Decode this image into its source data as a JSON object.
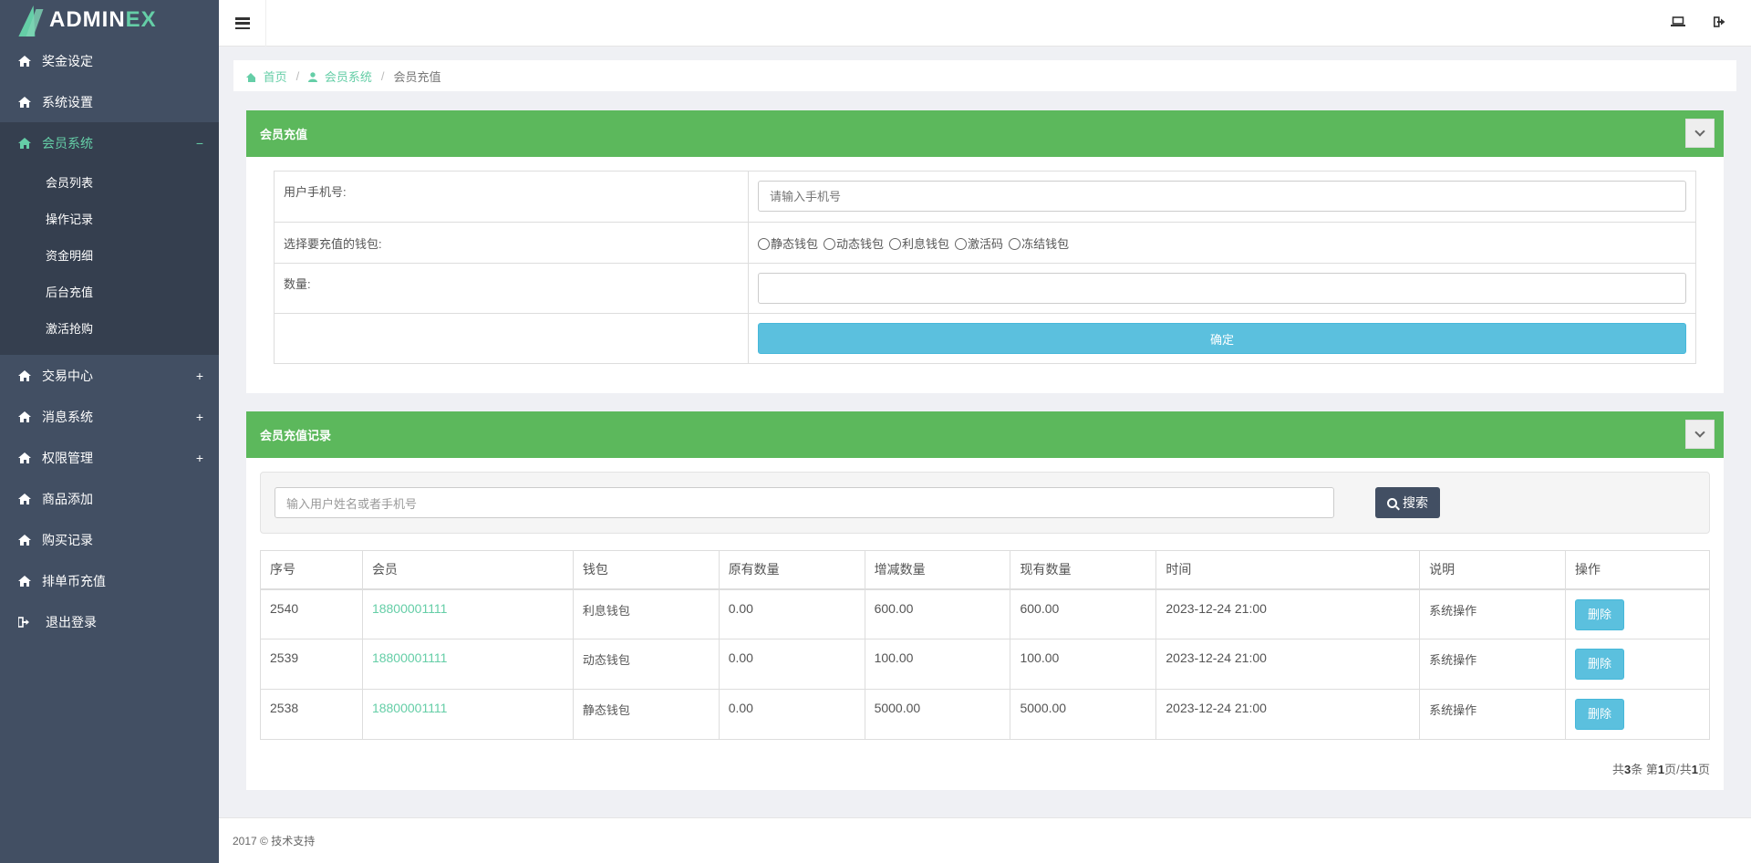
{
  "brand": {
    "part1": "ADMIN",
    "part2": "EX"
  },
  "sidebar": {
    "items": [
      {
        "label": "奖金设定",
        "toggle": ""
      },
      {
        "label": "系统设置",
        "toggle": ""
      },
      {
        "label": "会员系统",
        "toggle": "−"
      },
      {
        "label": "交易中心",
        "toggle": "+"
      },
      {
        "label": "消息系统",
        "toggle": "+"
      },
      {
        "label": "权限管理",
        "toggle": "+"
      },
      {
        "label": "商品添加",
        "toggle": ""
      },
      {
        "label": "购买记录",
        "toggle": ""
      },
      {
        "label": "排单币充值",
        "toggle": ""
      },
      {
        "label": "退出登录",
        "toggle": ""
      }
    ],
    "submenu": [
      "会员列表",
      "操作记录",
      "资金明细",
      "后台充值",
      "激活抢购"
    ]
  },
  "breadcrumb": {
    "home": "首页",
    "section": "会员系统",
    "current": "会员充值",
    "separator": "/"
  },
  "recharge_panel": {
    "title": "会员充值",
    "phone_label": "用户手机号:",
    "phone_placeholder": "请输入手机号",
    "wallet_label": "选择要充值的钱包:",
    "wallet_options": [
      "静态钱包",
      "动态钱包",
      "利息钱包",
      "激活码",
      "冻结钱包"
    ],
    "amount_label": "数量:",
    "amount_value": "",
    "confirm_label": "确定"
  },
  "records_panel": {
    "title": "会员充值记录",
    "search_placeholder": "输入用户姓名或者手机号",
    "search_label": "搜索",
    "columns": [
      "序号",
      "会员",
      "钱包",
      "原有数量",
      "增减数量",
      "现有数量",
      "时间",
      "说明",
      "操作"
    ],
    "rows": [
      {
        "id": "2540",
        "member": "18800001111",
        "wallet": "利息钱包",
        "original": "0.00",
        "change": "600.00",
        "current": "600.00",
        "time": "2023-12-24 21:00",
        "note": "系统操作",
        "action": "删除"
      },
      {
        "id": "2539",
        "member": "18800001111",
        "wallet": "动态钱包",
        "original": "0.00",
        "change": "100.00",
        "current": "100.00",
        "time": "2023-12-24 21:00",
        "note": "系统操作",
        "action": "删除"
      },
      {
        "id": "2538",
        "member": "18800001111",
        "wallet": "静态钱包",
        "original": "0.00",
        "change": "5000.00",
        "current": "5000.00",
        "time": "2023-12-24 21:00",
        "note": "系统操作",
        "action": "删除"
      }
    ],
    "pager": {
      "prefix": "共",
      "total": "3",
      "mid1": "条 第",
      "page": "1",
      "mid2": "页/共",
      "pages": "1",
      "suffix": "页"
    }
  },
  "footer": {
    "text": "2017 © 技术支持"
  },
  "colors": {
    "sidebar": "#424f63",
    "accent": "#65cea7",
    "panel_header": "#5cb85c",
    "info_button": "#5bc0de"
  }
}
